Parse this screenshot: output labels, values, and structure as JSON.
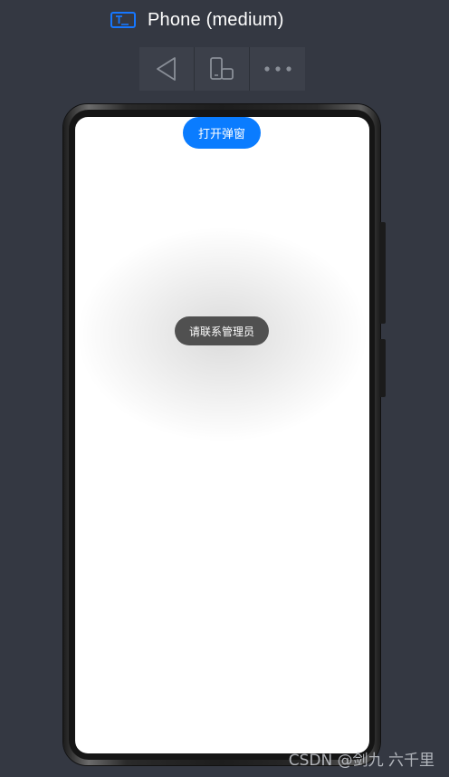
{
  "header": {
    "device_title": "Phone (medium)",
    "device_icon": "device-screen-icon",
    "accent_color": "#1677ff"
  },
  "toolbar": {
    "items": [
      {
        "icon": "back-triangle-icon"
      },
      {
        "icon": "rotate-device-icon"
      },
      {
        "icon": "more-dots-icon"
      }
    ]
  },
  "screen": {
    "open_dialog_label": "打开弹窗",
    "toast_text": "请联系管理员",
    "button_color": "#0a7cff"
  },
  "watermark": {
    "text": "CSDN @剑九 六千里"
  }
}
